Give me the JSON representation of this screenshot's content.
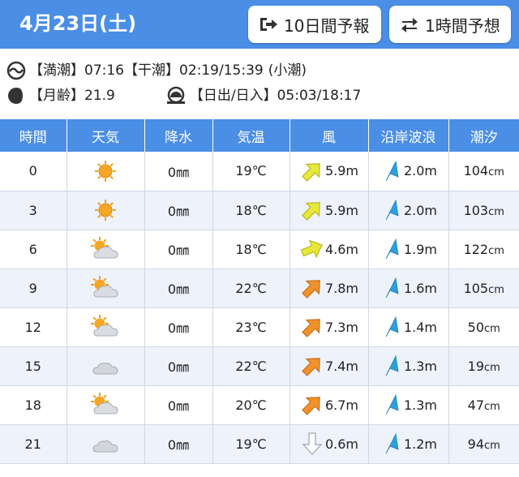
{
  "header": {
    "date": "4月23日(土)",
    "btn_10day": "10日間予報",
    "btn_1hour": "1時間予想",
    "accent_color": "#4a8ee6"
  },
  "info": {
    "high_tide_label": "【満潮】",
    "high_tide_value": "07:16",
    "low_tide_label": "【干潮】",
    "low_tide_value": "02:19/15:39",
    "tide_type": "(小潮)",
    "moon_label": "【月齢】",
    "moon_value": "21.9",
    "sun_label": "【日出/日入】",
    "sun_value": "05:03/18:17"
  },
  "table": {
    "headers": [
      "時間",
      "天気",
      "降水",
      "気温",
      "風",
      "沿岸波浪",
      "潮汐"
    ],
    "rows": [
      {
        "time": "0",
        "weather": "sunny",
        "rain": "0",
        "rain_unit": "㎜",
        "temp": "19℃",
        "wind_dir": "southwest",
        "wind": "5.9m",
        "wave": "2.0m",
        "tide": "104",
        "tide_unit": "cm"
      },
      {
        "time": "3",
        "weather": "sunny",
        "rain": "0",
        "rain_unit": "㎜",
        "temp": "18℃",
        "wind_dir": "southwest",
        "wind": "5.9m",
        "wave": "2.0m",
        "tide": "103",
        "tide_unit": "cm"
      },
      {
        "time": "6",
        "weather": "cloudy-sunny",
        "rain": "0",
        "rain_unit": "㎜",
        "temp": "18℃",
        "wind_dir": "west-southwest",
        "wind": "4.6m",
        "wave": "1.9m",
        "tide": "122",
        "tide_unit": "cm"
      },
      {
        "time": "9",
        "weather": "cloudy-sunny",
        "rain": "0",
        "rain_unit": "㎜",
        "temp": "22℃",
        "wind_dir": "southwest",
        "wind": "7.8m",
        "wave": "1.6m",
        "tide": "105",
        "tide_unit": "cm"
      },
      {
        "time": "12",
        "weather": "cloudy-sunny",
        "rain": "0",
        "rain_unit": "㎜",
        "temp": "23℃",
        "wind_dir": "southwest",
        "wind": "7.3m",
        "wave": "1.4m",
        "tide": "50",
        "tide_unit": "cm"
      },
      {
        "time": "15",
        "weather": "cloudy",
        "rain": "0",
        "rain_unit": "㎜",
        "temp": "22℃",
        "wind_dir": "southwest",
        "wind": "7.4m",
        "wave": "1.3m",
        "tide": "19",
        "tide_unit": "cm"
      },
      {
        "time": "18",
        "weather": "cloudy-sunny",
        "rain": "0",
        "rain_unit": "㎜",
        "temp": "20℃",
        "wind_dir": "west-southwest",
        "wind": "6.7m",
        "wave": "1.3m",
        "tide": "47",
        "tide_unit": "cm"
      },
      {
        "time": "21",
        "weather": "cloudy",
        "rain": "0",
        "rain_unit": "㎜",
        "temp": "19℃",
        "wind_dir": "north",
        "wind": "0.6m",
        "wave": "1.2m",
        "tide": "94",
        "tide_unit": "cm"
      }
    ]
  }
}
